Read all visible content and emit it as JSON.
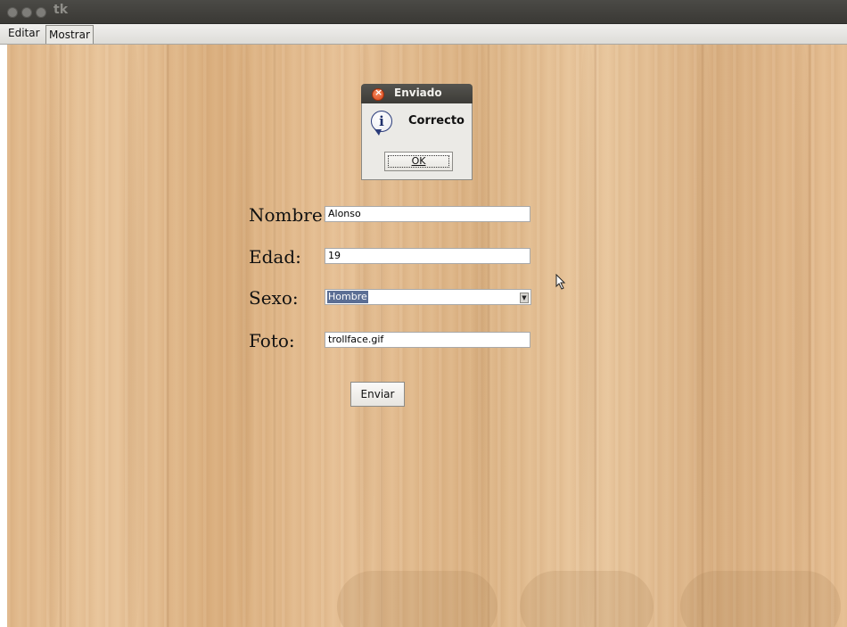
{
  "window": {
    "title": "tk"
  },
  "menubar": {
    "items": [
      "Editar",
      "Mostrar"
    ]
  },
  "form": {
    "nombre_label": "Nombre:",
    "nombre_value": "Alonso",
    "edad_label": "Edad:",
    "edad_value": "19",
    "sexo_label": "Sexo:",
    "sexo_value": "Hombre",
    "foto_label": "Foto:",
    "foto_value": "trollface.gif",
    "submit_label": "Enviar"
  },
  "dialog": {
    "title": "Enviado",
    "message": "Correcto",
    "ok_label": "OK",
    "icon": "info-icon"
  },
  "colors": {
    "titlebar": "#3c3b37",
    "selection": "#5b6e94",
    "wood": "#e2b987"
  }
}
